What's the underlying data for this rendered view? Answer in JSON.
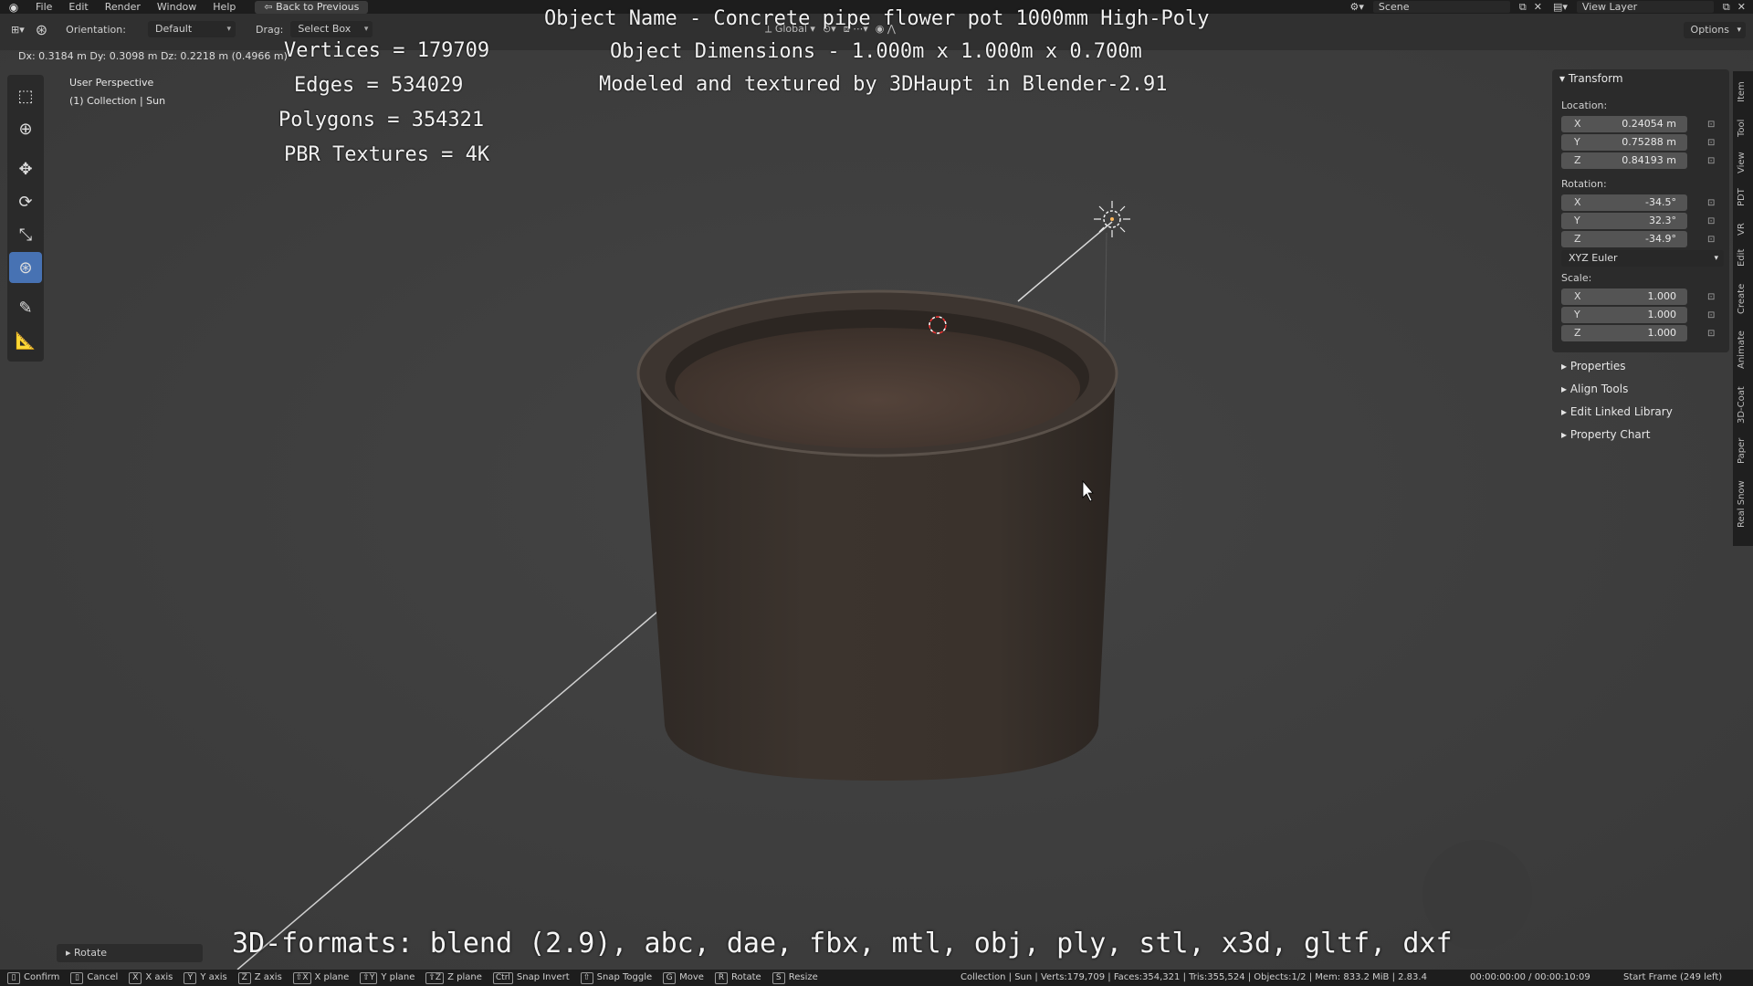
{
  "topbar": {
    "menus": [
      "File",
      "Edit",
      "Render",
      "Window",
      "Help"
    ],
    "back_button": "Back to Previous",
    "scene": "Scene",
    "view_layer": "View Layer"
  },
  "header": {
    "orientation_label": "Orientation:",
    "orientation_value": "Default",
    "drag_label": "Drag:",
    "drag_value": "Select Box",
    "transform_space": "Global",
    "options": "Options",
    "delta_readout": "Dx: 0.3184 m  Dy: 0.3098 m  Dz: 0.2218 m (0.4966 m)"
  },
  "viewport": {
    "perspective": "User Perspective",
    "collection": "(1) Collection | Sun",
    "stats": [
      "Vertices = 179709",
      "Edges = 534029",
      "Polygons = 354321",
      "PBR Textures = 4K"
    ],
    "title_lines": [
      "Object Name - Concrete pipe flower pot 1000mm High-Poly",
      "Object Dimensions -  1.000m x 1.000m x 0.700m",
      "Modeled and textured by 3DHaupt in Blender-2.91"
    ],
    "formats": "3D-formats: blend (2.9), abc, dae, fbx, mtl, obj, ply, stl, x3d, gltf, dxf"
  },
  "npanel": {
    "header": "Transform",
    "location_label": "Location:",
    "location": [
      {
        "axis": "X",
        "value": "0.24054 m"
      },
      {
        "axis": "Y",
        "value": "0.75288 m"
      },
      {
        "axis": "Z",
        "value": "0.84193 m"
      }
    ],
    "rotation_label": "Rotation:",
    "rotation": [
      {
        "axis": "X",
        "value": "-34.5°"
      },
      {
        "axis": "Y",
        "value": "32.3°"
      },
      {
        "axis": "Z",
        "value": "-34.9°"
      }
    ],
    "rotation_mode": "XYZ Euler",
    "scale_label": "Scale:",
    "scale": [
      {
        "axis": "X",
        "value": "1.000"
      },
      {
        "axis": "Y",
        "value": "1.000"
      },
      {
        "axis": "Z",
        "value": "1.000"
      }
    ],
    "collapsed_sections": [
      "Properties",
      "Align Tools",
      "Edit Linked Library",
      "Property Chart"
    ],
    "tabs": [
      "Item",
      "Tool",
      "View",
      "PDT",
      "VR",
      "Edit",
      "Create",
      "Animate",
      "3D-Coat",
      "Paper",
      "Real Snow"
    ]
  },
  "operator_panel": "Rotate",
  "statusbar": {
    "keys": [
      {
        "k": "",
        "label": "Confirm"
      },
      {
        "k": "",
        "label": "Cancel"
      },
      {
        "k": "X",
        "label": "X axis"
      },
      {
        "k": "Y",
        "label": "Y axis"
      },
      {
        "k": "Z",
        "label": "Z axis"
      },
      {
        "k": "⇧X",
        "label": "X plane"
      },
      {
        "k": "⇧Y",
        "label": "Y plane"
      },
      {
        "k": "⇧Z",
        "label": "Z plane"
      },
      {
        "k": "Ctrl",
        "label": "Snap Invert"
      },
      {
        "k": "⇧",
        "label": "Snap Toggle"
      },
      {
        "k": "G",
        "label": "Move"
      },
      {
        "k": "R",
        "label": "Rotate"
      },
      {
        "k": "S",
        "label": "Resize"
      }
    ],
    "info": "Collection | Sun | Verts:179,709 | Faces:354,321 | Tris:355,524 | Objects:1/2 | Mem: 833.2 MiB | 2.83.4",
    "time": "00:00:00:00 / 00:00:10:09",
    "frame": "Start Frame (249 left)"
  },
  "colors": {
    "accent": "#4772b3",
    "viewport_bg": "#3d3d3d",
    "pot": "#3a322c",
    "soil": "#4a3a30"
  }
}
